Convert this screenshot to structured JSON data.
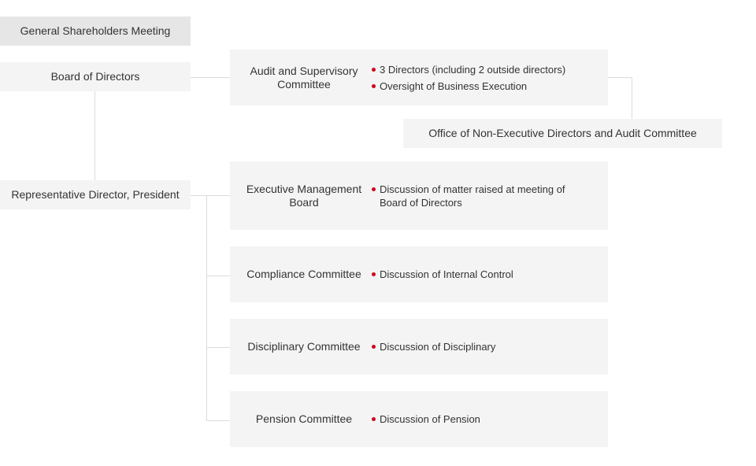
{
  "colors": {
    "box": "#f4f4f4",
    "top_box": "#e6e6e6",
    "line": "#dcdcdc",
    "bullet": "#d0021b",
    "text": "#333333"
  },
  "nodes": {
    "gsm": "General Shareholders Meeting",
    "board": "Board of Directors",
    "president": "Representative Director, President",
    "office": "Office of Non-Executive Directors and Audit Committee"
  },
  "committees": [
    {
      "name": "Audit and Supervisory Committee",
      "bullets": [
        "3 Directors (including 2 outside directors)",
        "Oversight of Business Execution"
      ]
    },
    {
      "name": "Executive Management Board",
      "bullets": [
        "Discussion of matter raised at meeting of Board of Directors"
      ]
    },
    {
      "name": "Compliance Committee",
      "bullets": [
        "Discussion of Internal Control"
      ]
    },
    {
      "name": "Disciplinary Committee",
      "bullets": [
        "Discussion of Disciplinary"
      ]
    },
    {
      "name": "Pension Committee",
      "bullets": [
        "Discussion of Pension"
      ]
    }
  ]
}
